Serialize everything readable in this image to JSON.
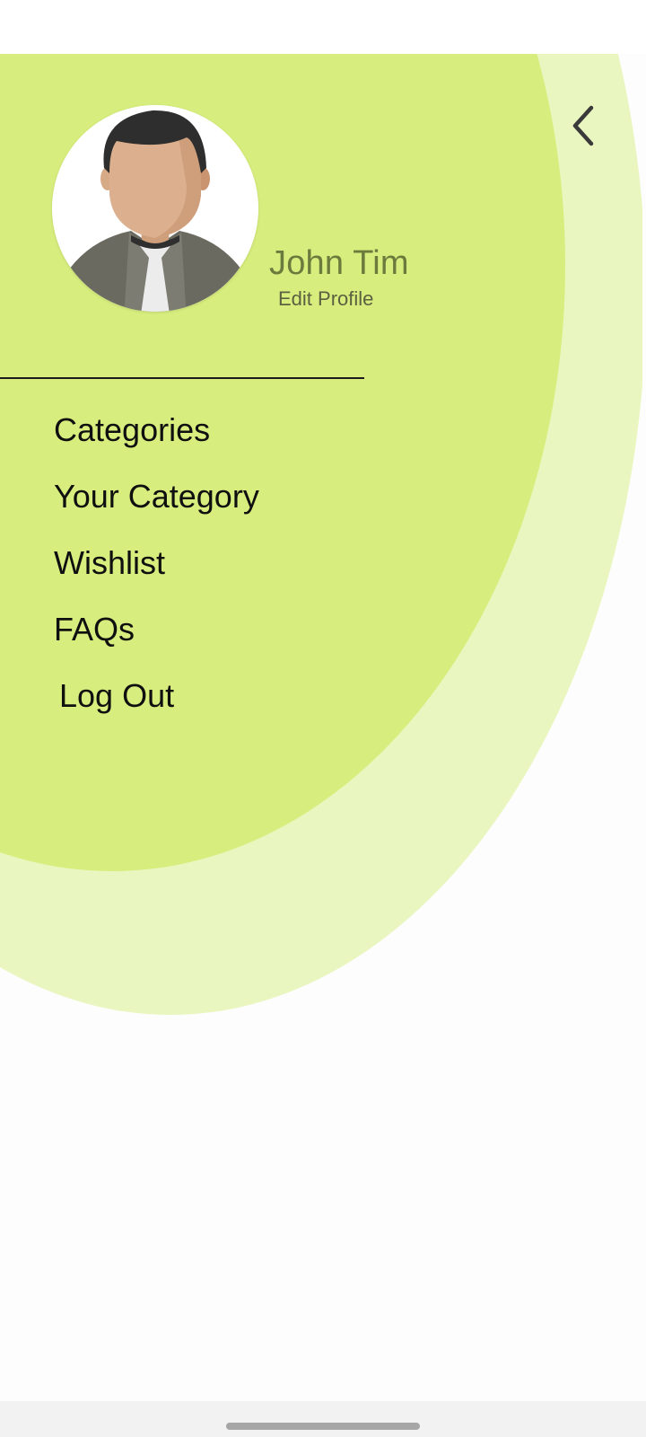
{
  "profile": {
    "name": "John Tim",
    "edit_label": "Edit Profile"
  },
  "menu": {
    "items": [
      {
        "label": "Categories"
      },
      {
        "label": "Your Category"
      },
      {
        "label": "Wishlist"
      },
      {
        "label": "FAQs"
      },
      {
        "label": "Log Out"
      }
    ]
  },
  "icons": {
    "back": "chevron-left-icon",
    "avatar": "user-avatar-icon"
  },
  "colors": {
    "inner_circle": "#d7ee7e",
    "outer_circle": "#eaf6bf",
    "name_text": "#6b7b3e",
    "menu_text": "#0f0f0f"
  }
}
